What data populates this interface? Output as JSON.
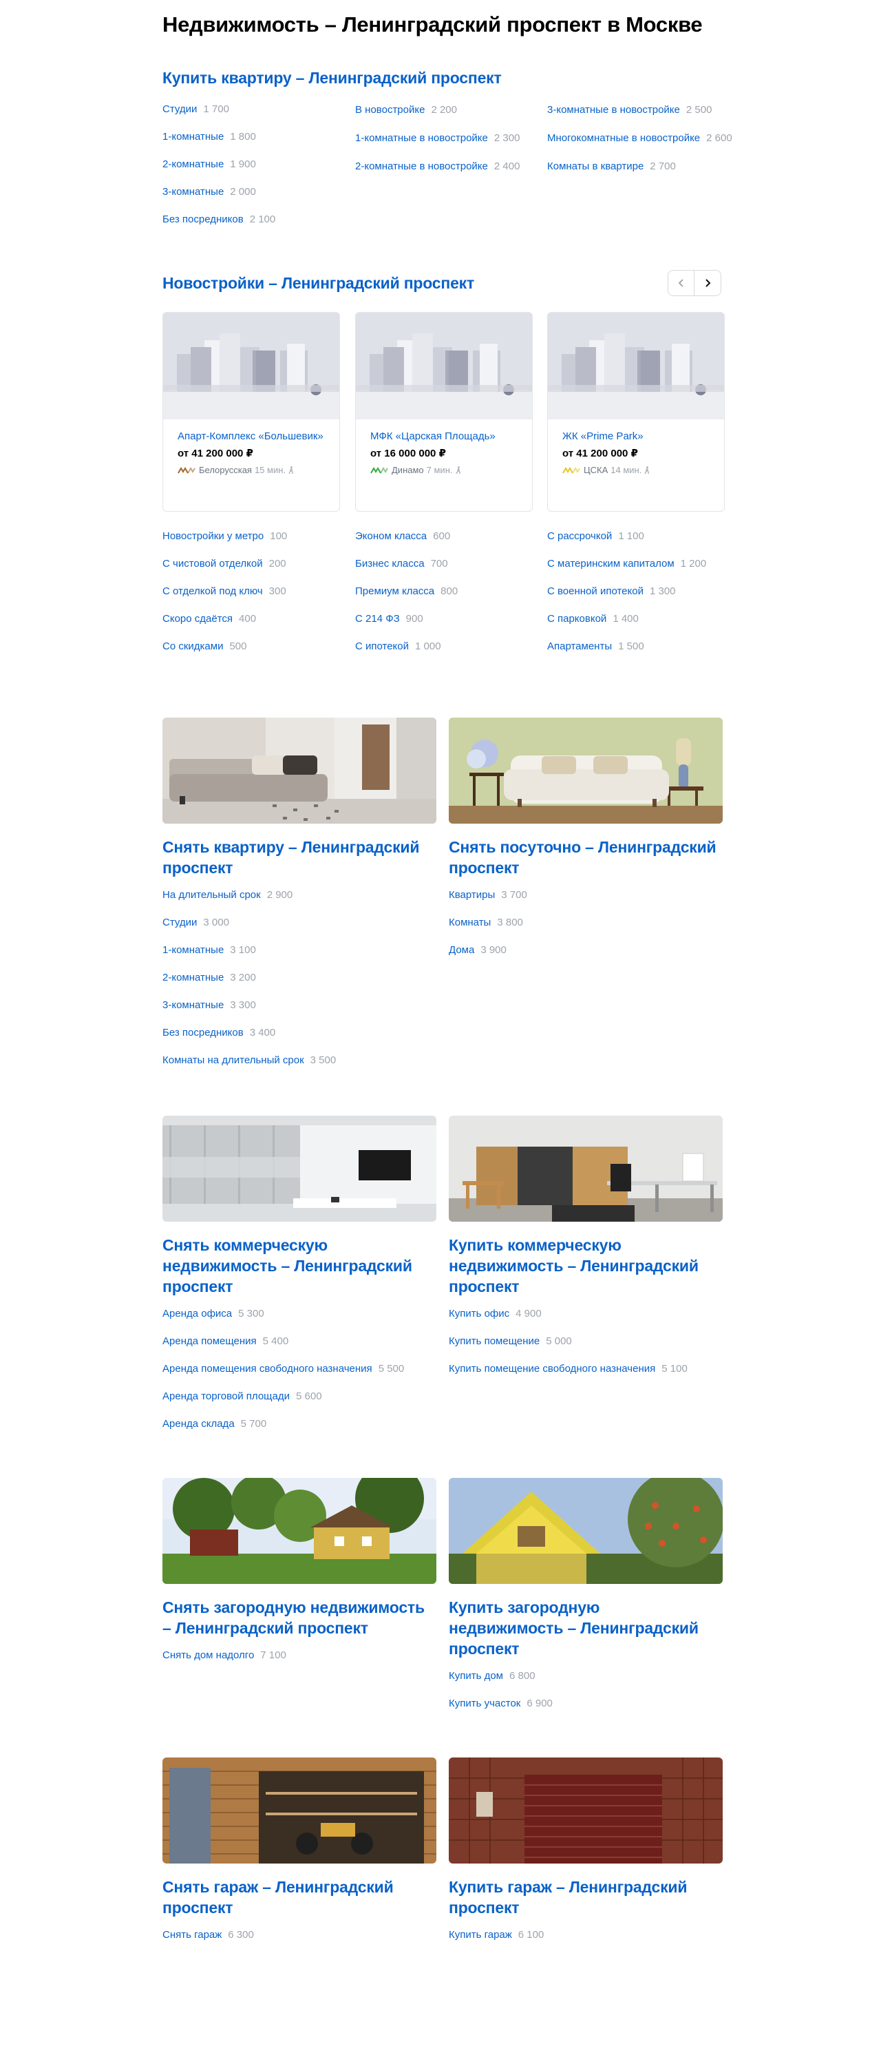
{
  "page_title": "Недвижимость – Ленинградский проспект в Москве",
  "buy": {
    "title": "Купить квартиру – Ленинградский проспект",
    "col1": [
      {
        "label": "Студии",
        "count": "1 700"
      },
      {
        "label": "1-комнатные",
        "count": "1 800"
      },
      {
        "label": "2-комнатные",
        "count": "1 900"
      },
      {
        "label": "3-комнатные",
        "count": "2 000"
      },
      {
        "label": "Без посредников",
        "count": "2 100"
      }
    ],
    "col2": [
      {
        "label": "В новостройке",
        "count": "2 200"
      },
      {
        "label": "1-комнатные в новостройке",
        "count": "2 300"
      },
      {
        "label": "2-комнатные в новостройке",
        "count": "2 400"
      }
    ],
    "col3": [
      {
        "label": "3-комнатные в новостройке",
        "count": "2 500"
      },
      {
        "label": "Многокомнатные в новостройке",
        "count": "2 600"
      },
      {
        "label": "Комнаты в квартире",
        "count": "2 700"
      }
    ]
  },
  "newbuilds": {
    "title": "Новостройки – Ленинградский проспект",
    "prev_icon": "chevron-left-icon",
    "next_icon": "chevron-right-icon",
    "cards": [
      {
        "name": "Апарт-Комплекс «Большевик»",
        "price": "от 41 200 000 ₽",
        "metro": "Белорусская",
        "time": "15 мин.",
        "metro_color": "#a5672a"
      },
      {
        "name": "МФК «Царская Площадь»",
        "price": "от 16 000 000 ₽",
        "metro": "Динамо",
        "time": "7 мин.",
        "metro_color": "#3aa93b"
      },
      {
        "name": "ЖК «Prime Park»",
        "price": "от 41 200 000 ₽",
        "metro": "ЦСКА",
        "time": "14 мин.",
        "metro_color": "#e8c522"
      }
    ],
    "col1": [
      {
        "label": "Новостройки у метро",
        "count": "100"
      },
      {
        "label": "С чистовой отделкой",
        "count": "200"
      },
      {
        "label": "С отделкой под ключ",
        "count": "300"
      },
      {
        "label": "Скоро сдаётся",
        "count": "400"
      },
      {
        "label": "Со скидками",
        "count": "500"
      }
    ],
    "col2": [
      {
        "label": "Эконом класса",
        "count": "600"
      },
      {
        "label": "Бизнес класса",
        "count": "700"
      },
      {
        "label": "Премиум класса",
        "count": "800"
      },
      {
        "label": "С 214 ФЗ",
        "count": "900"
      },
      {
        "label": "С ипотекой",
        "count": "1 000"
      }
    ],
    "col3": [
      {
        "label": "С рассрочкой",
        "count": "1 100"
      },
      {
        "label": "С материнским капиталом",
        "count": "1 200"
      },
      {
        "label": "С военной ипотекой",
        "count": "1 300"
      },
      {
        "label": "С парковкой",
        "count": "1 400"
      },
      {
        "label": "Апартаменты",
        "count": "1 500"
      }
    ]
  },
  "rent": {
    "title": "Снять квартиру – Ленинградский проспект",
    "items": [
      {
        "label": "На длительный срок",
        "count": "2 900"
      },
      {
        "label": "Студии",
        "count": "3 000"
      },
      {
        "label": "1-комнатные",
        "count": "3 100"
      },
      {
        "label": "2-комнатные",
        "count": "3 200"
      },
      {
        "label": "3-комнатные",
        "count": "3 300"
      },
      {
        "label": "Без посредников",
        "count": "3 400"
      },
      {
        "label": "Комнаты на длительный срок",
        "count": "3 500"
      }
    ]
  },
  "daily": {
    "title": "Снять посуточно – Ленинградский проспект",
    "items": [
      {
        "label": "Квартиры",
        "count": "3 700"
      },
      {
        "label": "Комнаты",
        "count": "3 800"
      },
      {
        "label": "Дома",
        "count": "3 900"
      }
    ]
  },
  "rent_commercial": {
    "title": "Снять коммерческую недвижимость – Ленинградский проспект",
    "items": [
      {
        "label": "Аренда офиса",
        "count": "5 300"
      },
      {
        "label": "Аренда помещения",
        "count": "5 400"
      },
      {
        "label": "Аренда помещения свободного назначения",
        "count": "5 500"
      },
      {
        "label": "Аренда торговой площади",
        "count": "5 600"
      },
      {
        "label": "Аренда склада",
        "count": "5 700"
      }
    ]
  },
  "buy_commercial": {
    "title": "Купить коммерческую недвижимость – Ленинградский проспект",
    "items": [
      {
        "label": "Купить офис",
        "count": "4 900"
      },
      {
        "label": "Купить помещение",
        "count": "5 000"
      },
      {
        "label": "Купить помещение свободного назначения",
        "count": "5 100"
      }
    ]
  },
  "rent_country": {
    "title": "Снять загородную недвижимость – Ленинградский проспект",
    "items": [
      {
        "label": "Снять дом надолго",
        "count": "7 100"
      }
    ]
  },
  "buy_country": {
    "title": "Купить загородную недвижимость – Ленинградский проспект",
    "items": [
      {
        "label": "Купить дом",
        "count": "6 800"
      },
      {
        "label": "Купить участок",
        "count": "6 900"
      }
    ]
  },
  "rent_garage": {
    "title": "Снять гараж – Ленинградский проспект",
    "items": [
      {
        "label": "Снять гараж",
        "count": "6 300"
      }
    ]
  },
  "buy_garage": {
    "title": "Купить гараж – Ленинградский проспект",
    "items": [
      {
        "label": "Купить гараж",
        "count": "6 100"
      }
    ]
  },
  "walk_icon": "pedestrian-icon",
  "accent_color": "#0a62c9",
  "count_color": "#9da3ab"
}
